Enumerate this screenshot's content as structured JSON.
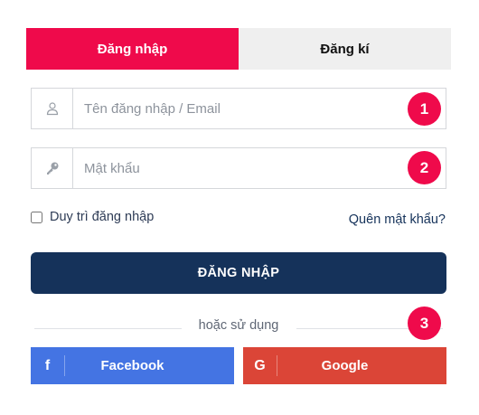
{
  "tabs": {
    "login": "Đăng nhập",
    "register": "Đăng kí"
  },
  "form": {
    "username_placeholder": "Tên đăng nhập / Email",
    "password_placeholder": "Mật khẩu",
    "remember_label": "Duy trì đăng nhập",
    "forgot_label": "Quên mật khẩu?",
    "submit_label": "ĐĂNG NHẬP"
  },
  "divider_text": "hoặc sử dụng",
  "social": {
    "facebook_label": "Facebook",
    "facebook_glyph": "f",
    "google_label": "Google",
    "google_glyph": "G"
  },
  "badges": [
    "1",
    "2",
    "3"
  ],
  "icons": {
    "username": "user-icon",
    "password": "key-icon"
  },
  "colors": {
    "accent": "#ef0a4b",
    "primary_dark": "#15325a",
    "facebook": "#4474e3",
    "google": "#db4537",
    "tab_inactive": "#efefef"
  }
}
